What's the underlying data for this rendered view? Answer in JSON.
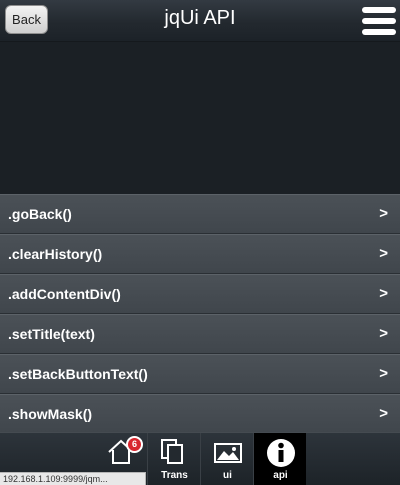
{
  "header": {
    "back_label": "Back",
    "title": "jqUi API",
    "menu_icon": "hamburger-menu-icon"
  },
  "list": {
    "items": [
      {
        "label": ".goBack()",
        "chevron": ">"
      },
      {
        "label": ".clearHistory()",
        "chevron": ">"
      },
      {
        "label": ".addContentDiv()",
        "chevron": ">"
      },
      {
        "label": ".setTitle(text)",
        "chevron": ">"
      },
      {
        "label": ".setBackButtonText()",
        "chevron": ">"
      },
      {
        "label": ".showMask()",
        "chevron": ">"
      }
    ]
  },
  "footer": {
    "tabs": [
      {
        "icon": "home-icon",
        "label": "",
        "badge": "6"
      },
      {
        "icon": "copy-pages-icon",
        "label": "Trans"
      },
      {
        "icon": "image-icon",
        "label": "ui"
      },
      {
        "icon": "info-icon",
        "label": "api",
        "active": true
      }
    ]
  },
  "status_bar": {
    "url": "192.168.1.109:9999/jqm..."
  },
  "colors": {
    "header_bg": "#2a3037",
    "list_item_bg": "#454b51",
    "active_tab_bg": "#000000",
    "badge_bg": "#d8262e"
  }
}
